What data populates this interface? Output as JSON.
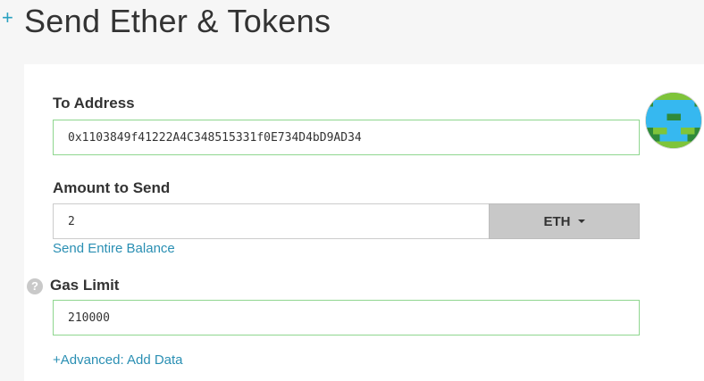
{
  "header": {
    "title": "Send Ether & Tokens",
    "toggle_icon": "plus-icon",
    "toggle_symbol": "+"
  },
  "form": {
    "to_address": {
      "label": "To Address",
      "value": "0x1103849f41222A4C348515331f0E734D4bD9AD34",
      "identicon": "address-identicon"
    },
    "amount": {
      "label": "Amount to Send",
      "value": "2",
      "unit": "ETH",
      "send_entire_balance_label": "Send Entire Balance"
    },
    "gas_limit": {
      "label": "Gas Limit",
      "value": "210000",
      "help_icon": "question-icon",
      "help_symbol": "?"
    },
    "advanced_link_label": "+Advanced: Add Data"
  },
  "colors": {
    "accent": "#2a8fb3",
    "valid_border": "#8fd68f",
    "identicon_blue": "#36b8f0",
    "identicon_green": "#2f8a3a",
    "identicon_lime": "#7fc43a"
  }
}
